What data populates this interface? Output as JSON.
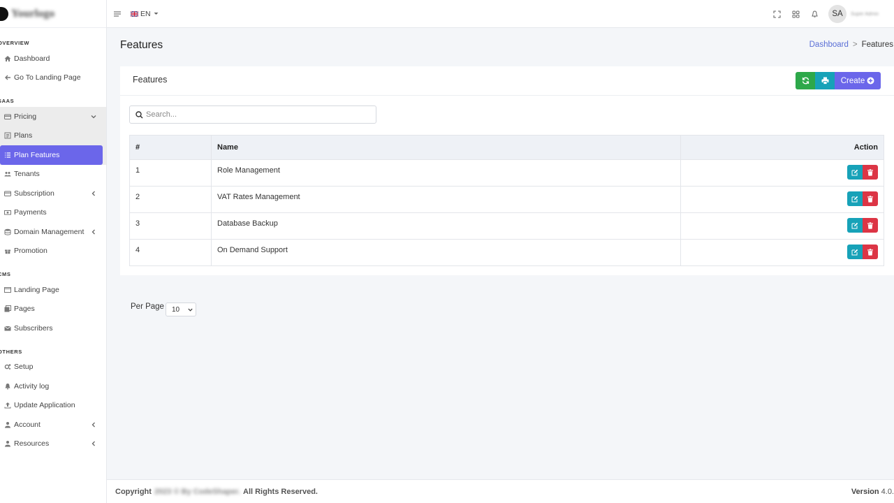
{
  "brand": {
    "name": "Yourlogo"
  },
  "topbar": {
    "language": "EN",
    "avatar_initials": "SA",
    "user_name": "Super Admin"
  },
  "sidebar": {
    "sections": [
      {
        "title": "Overview",
        "items": [
          {
            "label": "Dashboard"
          },
          {
            "label": "Go To Landing Page"
          }
        ]
      },
      {
        "title": "SaaS",
        "items": [
          {
            "label": "Pricing"
          },
          {
            "label": "Plans"
          },
          {
            "label": "Plan Features"
          },
          {
            "label": "Tenants"
          },
          {
            "label": "Subscription"
          },
          {
            "label": "Payments"
          },
          {
            "label": "Domain Management"
          },
          {
            "label": "Promotion"
          }
        ]
      },
      {
        "title": "CMS",
        "items": [
          {
            "label": "Landing Page"
          },
          {
            "label": "Pages"
          },
          {
            "label": "Subscribers"
          }
        ]
      },
      {
        "title": "Others",
        "items": [
          {
            "label": "Setup"
          },
          {
            "label": "Activity log"
          },
          {
            "label": "Update Application"
          },
          {
            "label": "Account"
          },
          {
            "label": "Resources"
          }
        ]
      }
    ]
  },
  "page": {
    "title": "Features",
    "breadcrumb": {
      "home": "Dashboard",
      "separator": ">",
      "current": "Features"
    }
  },
  "card": {
    "title": "Features",
    "create_label": "Create",
    "search_placeholder": "Search..."
  },
  "table": {
    "headers": {
      "index": "#",
      "name": "Name",
      "action": "Action"
    },
    "rows": [
      {
        "index": "1",
        "name": "Role Management"
      },
      {
        "index": "2",
        "name": "VAT Rates Management"
      },
      {
        "index": "3",
        "name": "Database Backup"
      },
      {
        "index": "4",
        "name": "On Demand Support"
      }
    ]
  },
  "pagination": {
    "per_page_label": "Per Page",
    "per_page_value": "10"
  },
  "footer": {
    "copyright_prefix": "Copyright",
    "copyright_blurred": "2023 © By CodeShaper.",
    "copyright_suffix": "All Rights Reserved.",
    "version_label": "Version",
    "version_value": "4.0."
  },
  "colors": {
    "accent": "#6b66ea",
    "success": "#2da84a",
    "info": "#17a2b8",
    "danger": "#dc3545"
  }
}
